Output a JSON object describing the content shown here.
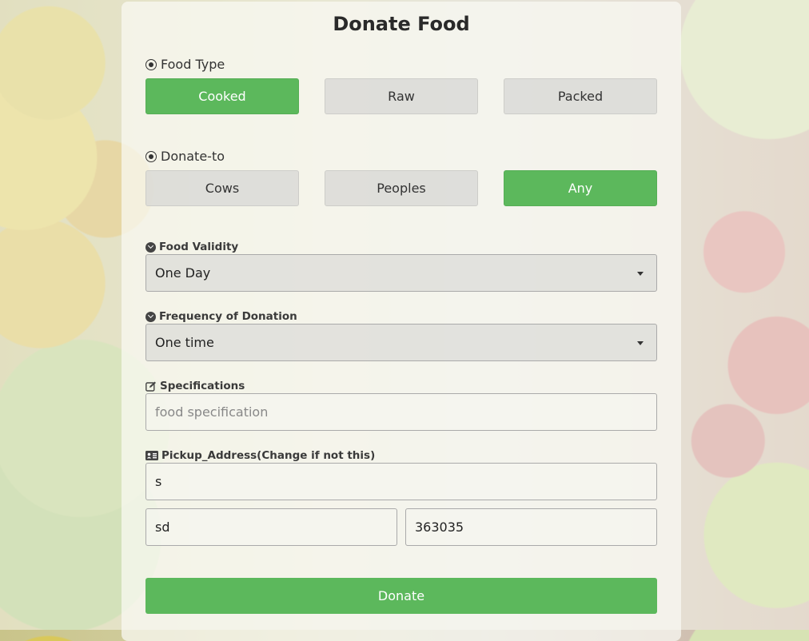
{
  "form": {
    "title": "Donate Food",
    "food_type": {
      "label": "Food Type",
      "options": [
        "Cooked",
        "Raw",
        "Packed"
      ],
      "selected": "Cooked"
    },
    "donate_to": {
      "label": "Donate-to",
      "options": [
        "Cows",
        "Peoples",
        "Any"
      ],
      "selected": "Any"
    },
    "food_validity": {
      "label": "Food Validity",
      "value": "One Day"
    },
    "frequency": {
      "label": "Frequency of Donation",
      "value": "One time"
    },
    "specifications": {
      "label": "Specifications",
      "placeholder": "food specification",
      "value": ""
    },
    "pickup_address": {
      "label": "Pickup_Address(Change if not this)",
      "line1": "s",
      "city": "sd",
      "pincode": "363035"
    },
    "submit_label": "Donate"
  },
  "colors": {
    "accent": "#5cb85c",
    "accent_text": "#ffffff"
  },
  "icons": {
    "section": "radio-selected-icon",
    "dropdown": "chevron-circle-down-icon",
    "specifications": "edit-icon",
    "address": "id-card-icon"
  }
}
